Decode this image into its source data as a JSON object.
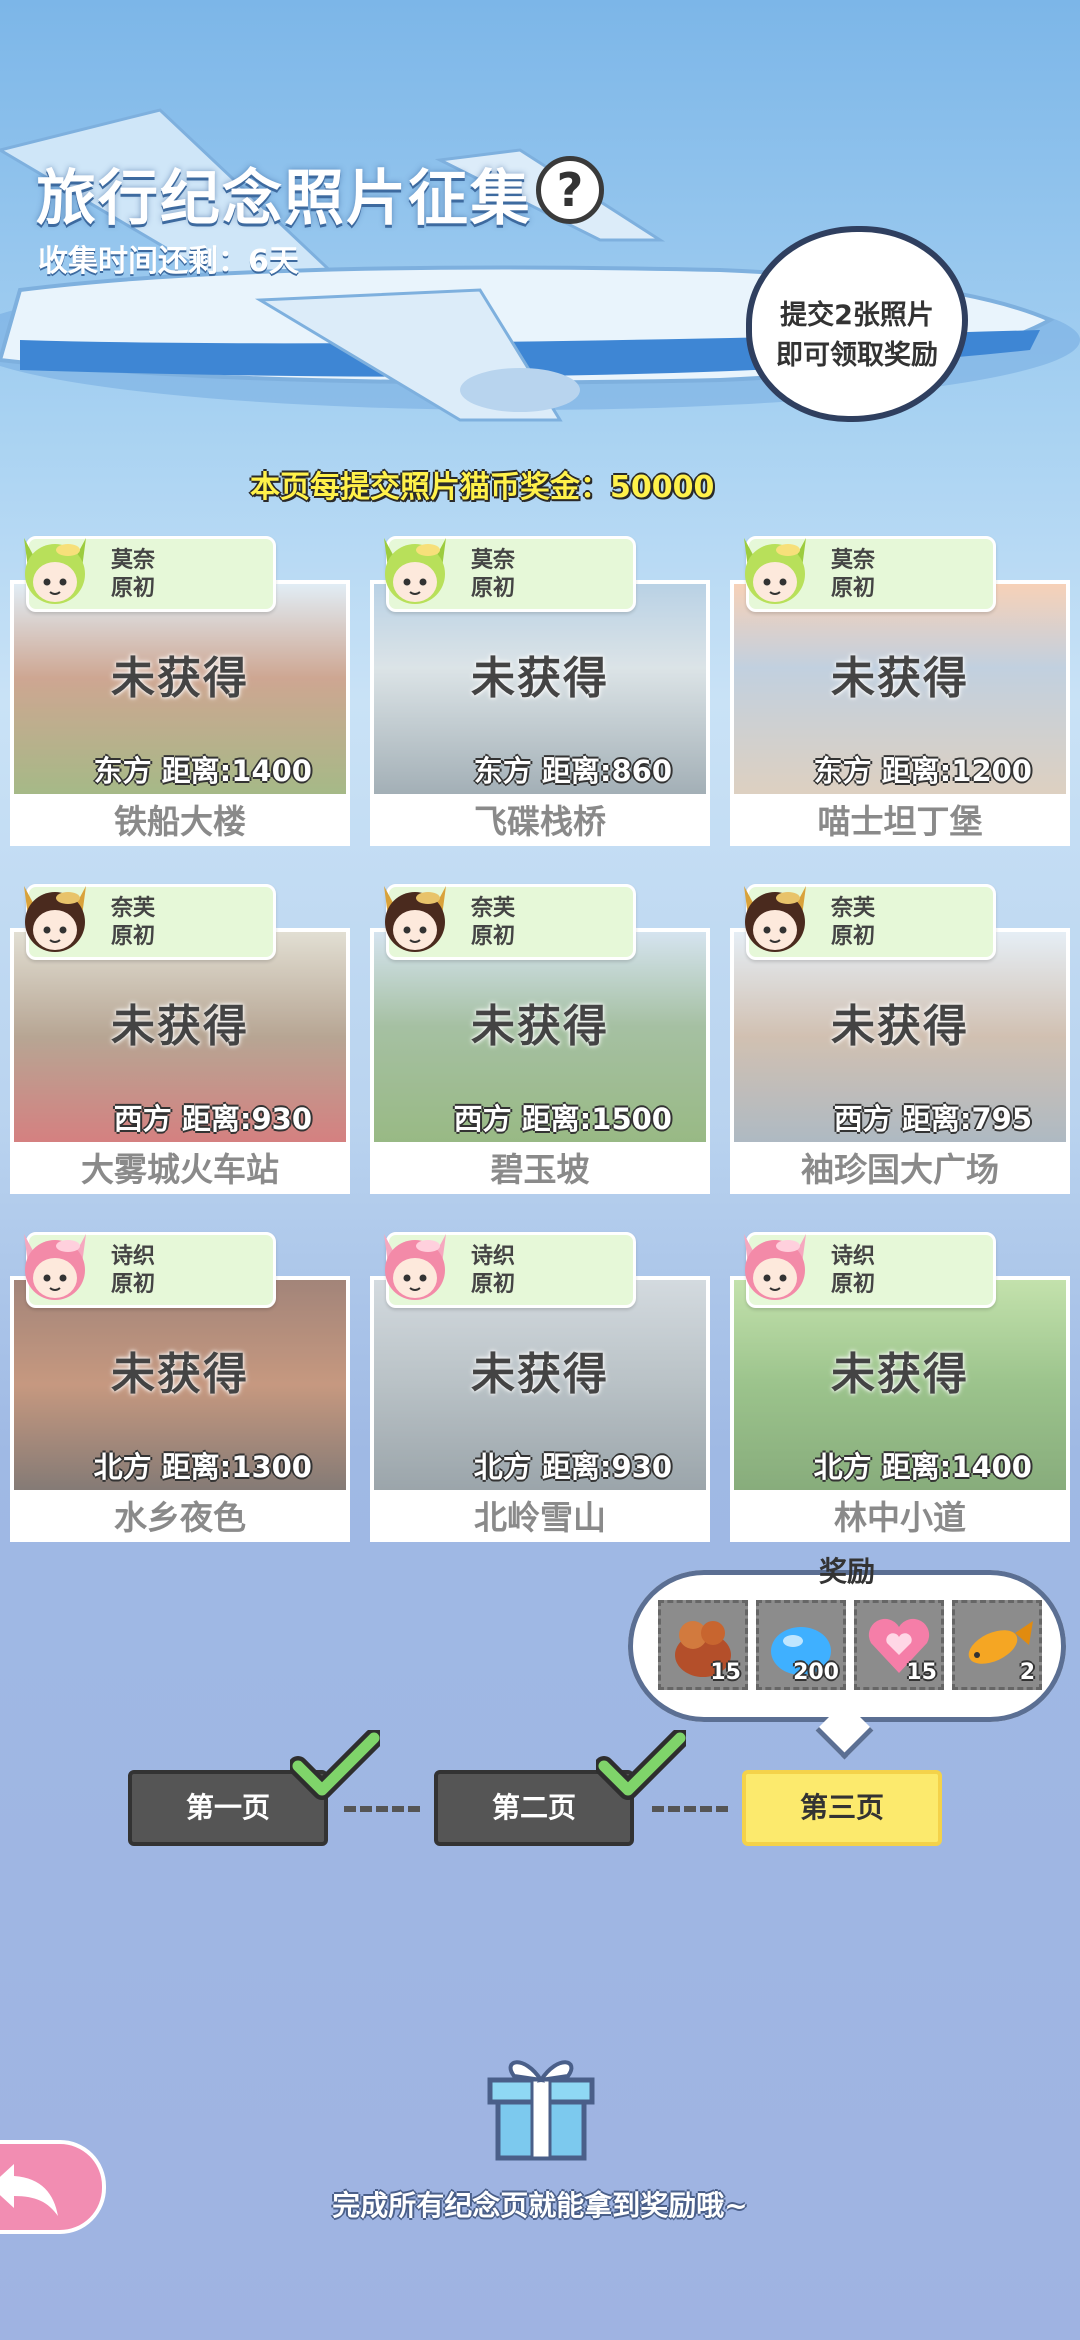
{
  "header": {
    "title": "旅行纪念照片征集",
    "help": "?",
    "timer": "收集时间还剩：6天"
  },
  "bubble": {
    "line1": "提交2张照片",
    "line2": "即可领取奖励"
  },
  "bonus": "本页每提交照片猫币奖金：50000",
  "cards": [
    {
      "char": "莫奈",
      "rank": "原初",
      "status": "未获得",
      "dist": "东方  距离:1400",
      "label": "铁船大楼"
    },
    {
      "char": "莫奈",
      "rank": "原初",
      "status": "未获得",
      "dist": "东方  距离:860",
      "label": "飞碟栈桥"
    },
    {
      "char": "莫奈",
      "rank": "原初",
      "status": "未获得",
      "dist": "东方  距离:1200",
      "label": "喵士坦丁堡"
    },
    {
      "char": "奈芙",
      "rank": "原初",
      "status": "未获得",
      "dist": "西方  距离:930",
      "label": "大雾城火车站"
    },
    {
      "char": "奈芙",
      "rank": "原初",
      "status": "未获得",
      "dist": "西方  距离:1500",
      "label": "碧玉坡"
    },
    {
      "char": "奈芙",
      "rank": "原初",
      "status": "未获得",
      "dist": "西方  距离:795",
      "label": "袖珍国大广场"
    },
    {
      "char": "诗织",
      "rank": "原初",
      "status": "未获得",
      "dist": "北方  距离:1300",
      "label": "水乡夜色"
    },
    {
      "char": "诗织",
      "rank": "原初",
      "status": "未获得",
      "dist": "北方  距离:930",
      "label": "北岭雪山"
    },
    {
      "char": "诗织",
      "rank": "原初",
      "status": "未获得",
      "dist": "北方  距离:1400",
      "label": "林中小道"
    }
  ],
  "reward": {
    "title": "奖励",
    "items": [
      {
        "icon": "treat-bag-icon",
        "count": "15"
      },
      {
        "icon": "blue-slime-icon",
        "count": "200"
      },
      {
        "icon": "heart-donut-icon",
        "count": "15"
      },
      {
        "icon": "fish-icon",
        "count": "2"
      }
    ]
  },
  "pages": [
    {
      "label": "第一页",
      "done": true
    },
    {
      "label": "第二页",
      "done": true
    },
    {
      "label": "第三页",
      "done": false
    }
  ],
  "footer": {
    "note": "完成所有纪念页就能拿到奖励哦~"
  }
}
